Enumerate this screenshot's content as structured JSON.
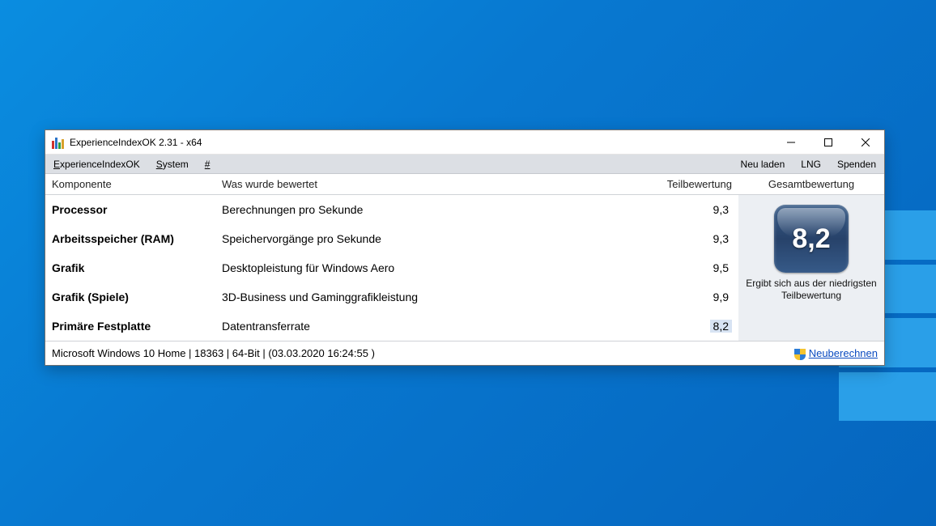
{
  "window": {
    "title": "ExperienceIndexOK 2.31 - x64"
  },
  "menu": {
    "left": [
      {
        "label_html": "ExperienceIndexOK",
        "underline_first": true,
        "raw": "ExperienceIndexOK"
      },
      {
        "label_html": "System",
        "underline_first": true,
        "raw": "System"
      },
      {
        "label_html": "#",
        "underline_first": true,
        "raw": "#"
      }
    ],
    "right": [
      {
        "label": "Neu laden"
      },
      {
        "label": "LNG"
      },
      {
        "label": "Spenden"
      }
    ]
  },
  "headers": {
    "component": "Komponente",
    "rated": "Was wurde bewertet",
    "subscore": "Teilbewertung",
    "overall": "Gesamtbewertung"
  },
  "rows": [
    {
      "component": "Processor",
      "rated": "Berechnungen pro Sekunde",
      "subscore": "9,3",
      "lowest": false
    },
    {
      "component": "Arbeitsspeicher (RAM)",
      "rated": "Speichervorgänge pro Sekunde",
      "subscore": "9,3",
      "lowest": false
    },
    {
      "component": "Grafik",
      "rated": "Desktopleistung für Windows Aero",
      "subscore": "9,5",
      "lowest": false
    },
    {
      "component": "Grafik (Spiele)",
      "rated": "3D-Business und Gaminggrafikleistung",
      "subscore": "9,9",
      "lowest": false
    },
    {
      "component": "Primäre Festplatte",
      "rated": "Datentransferrate",
      "subscore": "8,2",
      "lowest": true
    }
  ],
  "overall": {
    "score": "8,2",
    "note": "Ergibt sich aus der niedrigsten Teilbewertung"
  },
  "footer": {
    "sysinfo": "Microsoft Windows 10 Home | 18363 | 64-Bit | (03.03.2020 16:24:55 )",
    "recalc": "Neuberechnen"
  }
}
